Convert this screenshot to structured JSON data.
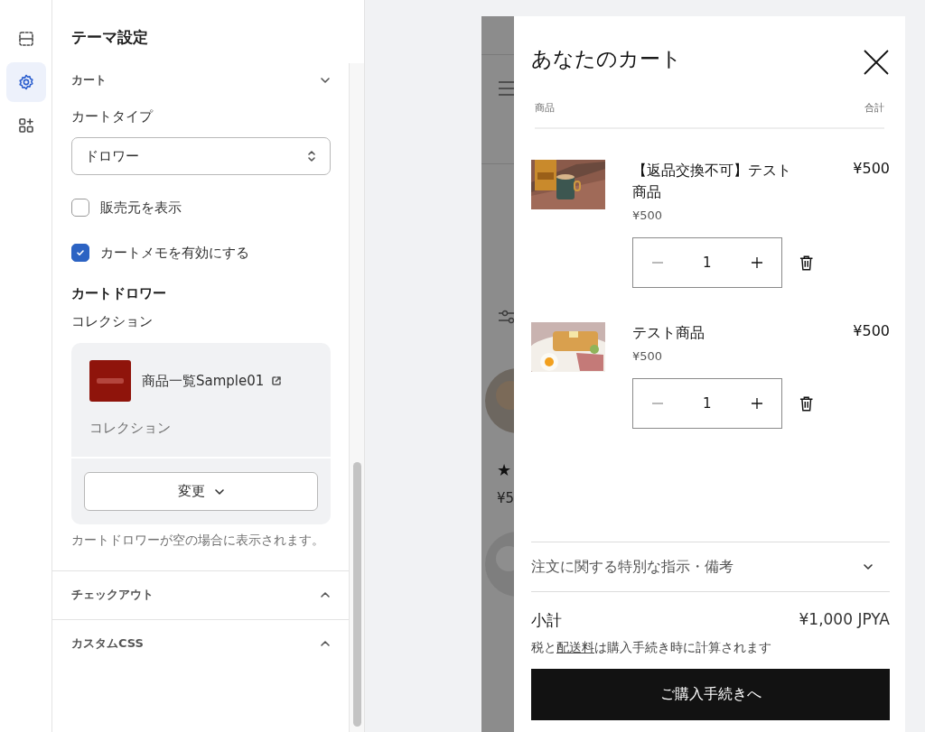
{
  "rail": [
    {
      "kind": "sections",
      "selected": false
    },
    {
      "kind": "settings",
      "selected": true
    },
    {
      "kind": "apps",
      "selected": false
    }
  ],
  "settings": {
    "title": "テーマ設定",
    "section": {
      "label": "カート",
      "expanded": true
    },
    "cart_type": {
      "label": "カートタイプ",
      "value": "ドロワー"
    },
    "checkboxes": [
      {
        "label": "販売元を表示",
        "checked": false
      },
      {
        "label": "カートメモを有効にする",
        "checked": true
      }
    ],
    "heading": "カートドロワー",
    "collection": {
      "label": "コレクション",
      "name": "商品一覧Sample01",
      "type": "コレクション",
      "button": "変更",
      "help": "カートドロワーが空の場合に表示されます。"
    },
    "sections": [
      {
        "label": "チェックアウト",
        "expanded": false
      },
      {
        "label": "カスタムCSS",
        "expanded": false
      }
    ]
  },
  "storefront": {
    "rating": "★",
    "price": "¥5"
  },
  "drawer": {
    "title": "あなたのカート",
    "columns": [
      "商品",
      "合計"
    ],
    "items": [
      {
        "name": "【返品交換不可】テスト商品",
        "price": "¥500",
        "total": "¥500",
        "quantity": "1"
      },
      {
        "name": "テスト商品",
        "price": "¥500",
        "total": "¥500",
        "quantity": "1"
      }
    ],
    "note": {
      "label": "注文に関する特別な指示・備考",
      "expanded": false
    },
    "subtotal": {
      "label": "小計",
      "value": "¥1,000 JPYA"
    },
    "tax_note": {
      "before": "税と",
      "link": "配送料",
      "after": "は購入手続き時に計算されます"
    },
    "checkout": "ご購入手続きへ"
  }
}
